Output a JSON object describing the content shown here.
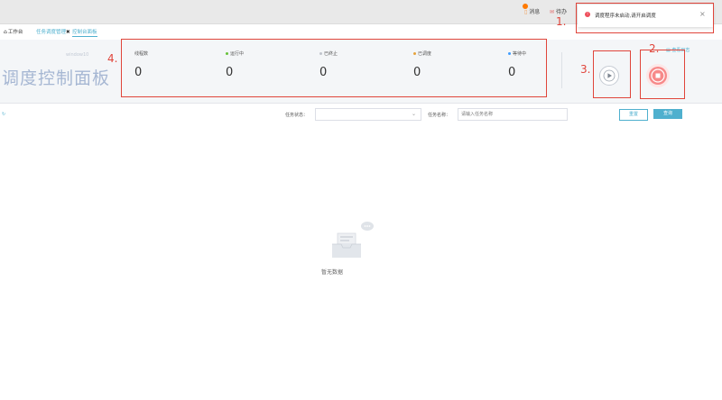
{
  "topbar": {
    "messages_label": "消息",
    "todo_label": "待办"
  },
  "tabs": [
    {
      "label": "工作台"
    },
    {
      "label": "任务调度管理"
    },
    {
      "label": "控制台面板"
    }
  ],
  "hero": {
    "title": "调度控制面板",
    "subtitle": "window10",
    "log_label": "查看日志"
  },
  "stats": [
    {
      "label": "线程数",
      "value": "0",
      "dot_color": ""
    },
    {
      "label": "运行中",
      "value": "0",
      "dot_color": "#67c23a"
    },
    {
      "label": "已终止",
      "value": "0",
      "dot_color": "#c0c4cc"
    },
    {
      "label": "已调度",
      "value": "0",
      "dot_color": "#e6a23c"
    },
    {
      "label": "等待中",
      "value": "0",
      "dot_color": "#409eff"
    }
  ],
  "annotations": [
    "1.",
    "2.",
    "3.",
    "4."
  ],
  "filters": {
    "status_label": "任务状态：",
    "status_value": "",
    "name_label": "任务名称：",
    "name_placeholder": "请输入任务名称",
    "reset_label": "重置",
    "search_label": "查询"
  },
  "empty": {
    "label": "暂无数据"
  },
  "notification": {
    "text": "调度程序未启动,请开启调度",
    "close": "×"
  },
  "colors": {
    "accent": "#4fb0ce",
    "danger": "#e0453b",
    "hero_title": "#a6b7d3"
  }
}
